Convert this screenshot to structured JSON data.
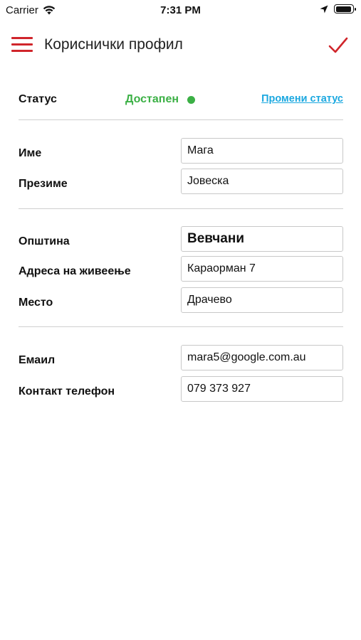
{
  "status_bar": {
    "carrier": "Carrier",
    "time": "7:31 PM",
    "battery_level": 0.95
  },
  "header": {
    "title": "Кориснички профил"
  },
  "status": {
    "label": "Статус",
    "value": "Достапен",
    "change_link": "Промени статус"
  },
  "personal": {
    "first_name_label": "Име",
    "first_name_value": "Мага",
    "last_name_label": "Презиме",
    "last_name_value": "Јовеска"
  },
  "address": {
    "municipality_label": "Општина",
    "municipality_value": "Вевчани",
    "street_label": "Адреса на живеење",
    "street_value": "Караорман 7",
    "place_label": "Место",
    "place_value": "Драчево"
  },
  "contact": {
    "email_label": "Емаил",
    "email_value": "mara5@google.com.au",
    "phone_label": "Контакт телефон",
    "phone_value": "079 373 927"
  },
  "colors": {
    "accent": "#d0252b",
    "available": "#3bb045",
    "link": "#1ba8e0"
  },
  "icons": {
    "menu": "hamburger-menu-icon",
    "save": "checkmark-icon",
    "wifi": "wifi-icon",
    "location": "location-arrow-icon",
    "battery": "battery-icon"
  }
}
